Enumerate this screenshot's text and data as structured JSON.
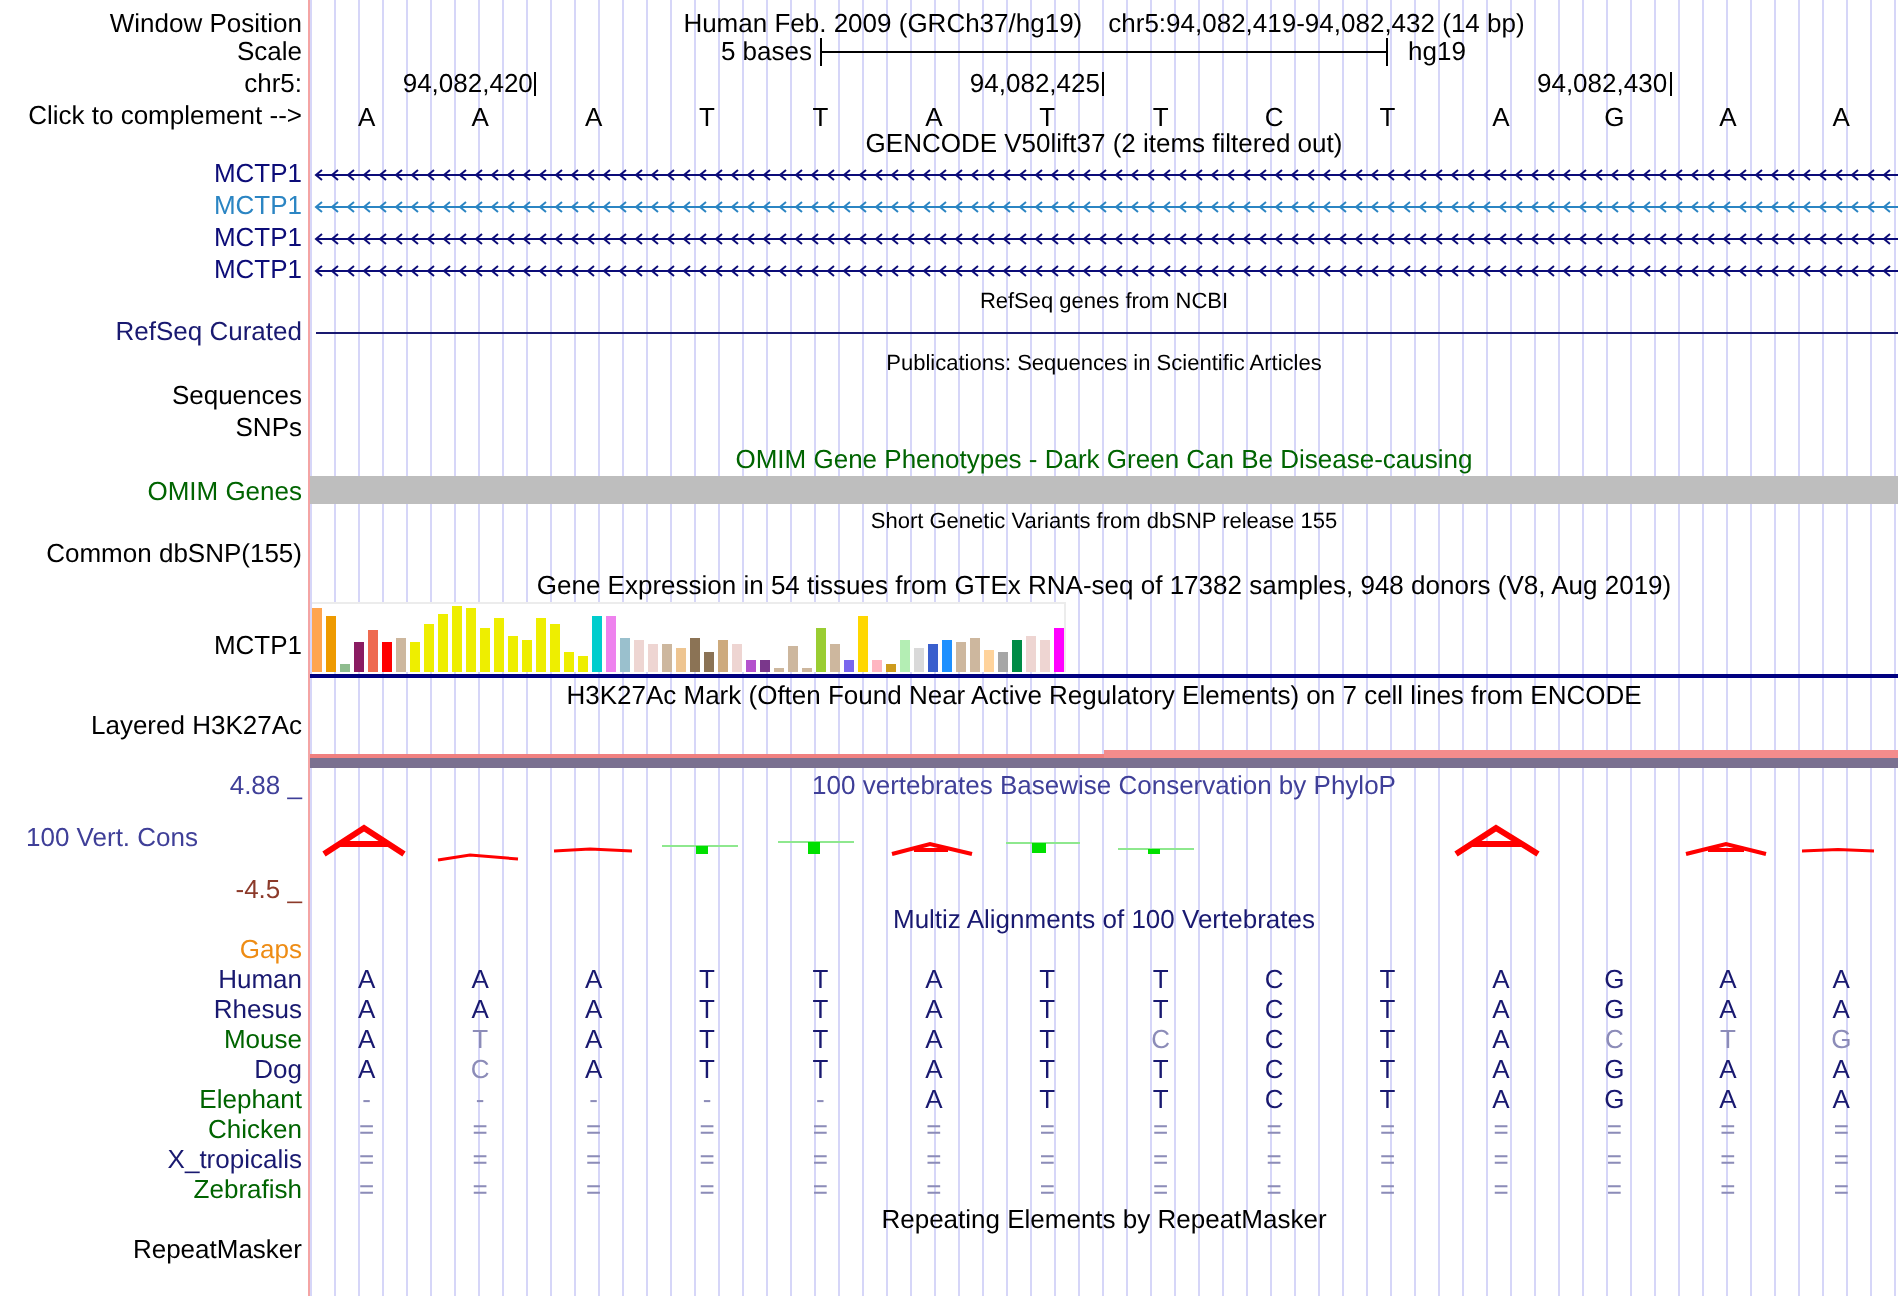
{
  "header": {
    "position": {
      "label": "Window Position",
      "assembly": "Human Feb. 2009 (GRCh37/hg19)",
      "range": "chr5:94,082,419-94,082,432 (14 bp)"
    },
    "scale": {
      "label": "Scale",
      "length": "5 bases",
      "assembly": "hg19"
    },
    "ruler": {
      "label": "chr5:"
    },
    "sequence": {
      "label": "Click to complement -->",
      "bases": [
        {
          "base": "A"
        },
        {
          "base": "A",
          "coordinate": "94,082,420"
        },
        {
          "base": "A"
        },
        {
          "base": "T"
        },
        {
          "base": "T"
        },
        {
          "base": "A"
        },
        {
          "base": "T",
          "coordinate": "94,082,425"
        },
        {
          "base": "T"
        },
        {
          "base": "C"
        },
        {
          "base": "T"
        },
        {
          "base": "A"
        },
        {
          "base": "G",
          "coordinate": "94,082,430"
        },
        {
          "base": "A"
        },
        {
          "base": "A"
        }
      ]
    }
  },
  "tracks": [
    {
      "kind": "genes",
      "title": "GENCODE V50lift37 (2 items filtered out)",
      "color": "#000000",
      "items": [
        {
          "label": "MCTP1",
          "color": "#0c0c78"
        },
        {
          "label": "MCTP1",
          "color": "#2b85c3"
        },
        {
          "label": "MCTP1",
          "color": "#0c0c78"
        },
        {
          "label": "MCTP1",
          "color": "#0c0c78"
        }
      ]
    },
    {
      "kind": "line",
      "title": "RefSeq genes from NCBI",
      "color": "#000000",
      "labels": [
        {
          "text": "RefSeq Curated",
          "color": "#191970"
        }
      ]
    },
    {
      "kind": "sparse",
      "title": "Publications: Sequences in Scientific Articles",
      "color": "#000000",
      "labels": [
        {
          "text": "Sequences",
          "color": "#000000"
        },
        {
          "text": "SNPs",
          "color": "#000000"
        }
      ]
    },
    {
      "kind": "bar",
      "title": "OMIM Gene Phenotypes - Dark Green Can Be Disease-causing",
      "color": "#006400",
      "labels": [
        {
          "text": "OMIM Genes",
          "color": "#006400"
        }
      ]
    },
    {
      "kind": "sparse",
      "title": "Short Genetic Variants from dbSNP release 155",
      "color": "#000000",
      "labels": [
        {
          "text": "Common dbSNP(155)",
          "color": "#000000"
        }
      ]
    },
    {
      "kind": "expression",
      "title": "Gene Expression in 54 tissues from GTEx RNA-seq of 17382 samples, 948 donors (V8, Aug 2019)",
      "color": "#000000",
      "labels": [
        {
          "text": "MCTP1",
          "color": "#000000"
        }
      ]
    },
    {
      "kind": "layered",
      "title": "H3K27Ac Mark (Often Found Near Active Regulatory Elements) on 7 cell lines from ENCODE",
      "color": "#000000",
      "labels": [
        {
          "text": "Layered H3K27Ac",
          "color": "#000000"
        }
      ]
    },
    {
      "kind": "conservation",
      "title": "100 vertebrates Basewise Conservation by PhyloP",
      "color": "#3f3f98",
      "labels": [
        {
          "text": "100 Vert. Cons",
          "color": "#3f3f98"
        }
      ],
      "scale_max": {
        "text": "4.88 _",
        "color": "#3f3f98"
      },
      "scale_min": {
        "text": "-4.5 _",
        "color": "#8c3a2a"
      }
    },
    {
      "kind": "alignment",
      "title": "Multiz Alignments of 100 Vertebrates",
      "color": "#191970",
      "labels": [
        {
          "text": "Gaps",
          "color": "#ee8c14"
        }
      ],
      "species": [
        {
          "name": "Human",
          "color": "#191970",
          "bases": [
            {
              "base": "A",
              "faded": false
            },
            {
              "base": "A",
              "faded": false
            },
            {
              "base": "A",
              "faded": false
            },
            {
              "base": "T",
              "faded": false
            },
            {
              "base": "T",
              "faded": false
            },
            {
              "base": "A",
              "faded": false
            },
            {
              "base": "T",
              "faded": false
            },
            {
              "base": "T",
              "faded": false
            },
            {
              "base": "C",
              "faded": false
            },
            {
              "base": "T",
              "faded": false
            },
            {
              "base": "A",
              "faded": false
            },
            {
              "base": "G",
              "faded": false
            },
            {
              "base": "A",
              "faded": false
            },
            {
              "base": "A",
              "faded": false
            }
          ]
        },
        {
          "name": "Rhesus",
          "color": "#191970",
          "bases": [
            {
              "base": "A",
              "faded": false
            },
            {
              "base": "A",
              "faded": false
            },
            {
              "base": "A",
              "faded": false
            },
            {
              "base": "T",
              "faded": false
            },
            {
              "base": "T",
              "faded": false
            },
            {
              "base": "A",
              "faded": false
            },
            {
              "base": "T",
              "faded": false
            },
            {
              "base": "T",
              "faded": false
            },
            {
              "base": "C",
              "faded": false
            },
            {
              "base": "T",
              "faded": false
            },
            {
              "base": "A",
              "faded": false
            },
            {
              "base": "G",
              "faded": false
            },
            {
              "base": "A",
              "faded": false
            },
            {
              "base": "A",
              "faded": false
            }
          ]
        },
        {
          "name": "Mouse",
          "color": "#006400",
          "bases": [
            {
              "base": "A",
              "faded": false
            },
            {
              "base": "T",
              "faded": true
            },
            {
              "base": "A",
              "faded": false
            },
            {
              "base": "T",
              "faded": false
            },
            {
              "base": "T",
              "faded": false
            },
            {
              "base": "A",
              "faded": false
            },
            {
              "base": "T",
              "faded": false
            },
            {
              "base": "C",
              "faded": true
            },
            {
              "base": "C",
              "faded": false
            },
            {
              "base": "T",
              "faded": false
            },
            {
              "base": "A",
              "faded": false
            },
            {
              "base": "C",
              "faded": true
            },
            {
              "base": "T",
              "faded": true
            },
            {
              "base": "G",
              "faded": true
            }
          ]
        },
        {
          "name": "Dog",
          "color": "#191970",
          "bases": [
            {
              "base": "A",
              "faded": false
            },
            {
              "base": "C",
              "faded": true
            },
            {
              "base": "A",
              "faded": false
            },
            {
              "base": "T",
              "faded": false
            },
            {
              "base": "T",
              "faded": false
            },
            {
              "base": "A",
              "faded": false
            },
            {
              "base": "T",
              "faded": false
            },
            {
              "base": "T",
              "faded": false
            },
            {
              "base": "C",
              "faded": false
            },
            {
              "base": "T",
              "faded": false
            },
            {
              "base": "A",
              "faded": false
            },
            {
              "base": "G",
              "faded": false
            },
            {
              "base": "A",
              "faded": false
            },
            {
              "base": "A",
              "faded": false
            }
          ]
        },
        {
          "name": "Elephant",
          "color": "#006400",
          "bases": [
            {
              "base": "-",
              "faded": true
            },
            {
              "base": "-",
              "faded": true
            },
            {
              "base": "-",
              "faded": true
            },
            {
              "base": "-",
              "faded": true
            },
            {
              "base": "-",
              "faded": true
            },
            {
              "base": "A",
              "faded": false
            },
            {
              "base": "T",
              "faded": false
            },
            {
              "base": "T",
              "faded": false
            },
            {
              "base": "C",
              "faded": false
            },
            {
              "base": "T",
              "faded": false
            },
            {
              "base": "A",
              "faded": false
            },
            {
              "base": "G",
              "faded": false
            },
            {
              "base": "A",
              "faded": false
            },
            {
              "base": "A",
              "faded": false
            }
          ]
        },
        {
          "name": "Chicken",
          "color": "#006400",
          "bases": [
            {
              "base": "=",
              "faded": true
            },
            {
              "base": "=",
              "faded": true
            },
            {
              "base": "=",
              "faded": true
            },
            {
              "base": "=",
              "faded": true
            },
            {
              "base": "=",
              "faded": true
            },
            {
              "base": "=",
              "faded": true
            },
            {
              "base": "=",
              "faded": true
            },
            {
              "base": "=",
              "faded": true
            },
            {
              "base": "=",
              "faded": true
            },
            {
              "base": "=",
              "faded": true
            },
            {
              "base": "=",
              "faded": true
            },
            {
              "base": "=",
              "faded": true
            },
            {
              "base": "=",
              "faded": true
            },
            {
              "base": "=",
              "faded": true
            }
          ]
        },
        {
          "name": "X_tropicalis",
          "color": "#191970",
          "bases": [
            {
              "base": "=",
              "faded": true
            },
            {
              "base": "=",
              "faded": true
            },
            {
              "base": "=",
              "faded": true
            },
            {
              "base": "=",
              "faded": true
            },
            {
              "base": "=",
              "faded": true
            },
            {
              "base": "=",
              "faded": true
            },
            {
              "base": "=",
              "faded": true
            },
            {
              "base": "=",
              "faded": true
            },
            {
              "base": "=",
              "faded": true
            },
            {
              "base": "=",
              "faded": true
            },
            {
              "base": "=",
              "faded": true
            },
            {
              "base": "=",
              "faded": true
            },
            {
              "base": "=",
              "faded": true
            },
            {
              "base": "=",
              "faded": true
            }
          ]
        },
        {
          "name": "Zebrafish",
          "color": "#006400",
          "bases": [
            {
              "base": "=",
              "faded": true
            },
            {
              "base": "=",
              "faded": true
            },
            {
              "base": "=",
              "faded": true
            },
            {
              "base": "=",
              "faded": true
            },
            {
              "base": "=",
              "faded": true
            },
            {
              "base": "=",
              "faded": true
            },
            {
              "base": "=",
              "faded": true
            },
            {
              "base": "=",
              "faded": true
            },
            {
              "base": "=",
              "faded": true
            },
            {
              "base": "=",
              "faded": true
            },
            {
              "base": "=",
              "faded": true
            },
            {
              "base": "=",
              "faded": true
            },
            {
              "base": "=",
              "faded": true
            },
            {
              "base": "=",
              "faded": true
            }
          ]
        }
      ]
    },
    {
      "kind": "empty",
      "title": "Repeating Elements by RepeatMasker",
      "color": "#000000",
      "labels": [
        {
          "text": "RepeatMasker",
          "color": "#000000"
        }
      ]
    }
  ]
}
